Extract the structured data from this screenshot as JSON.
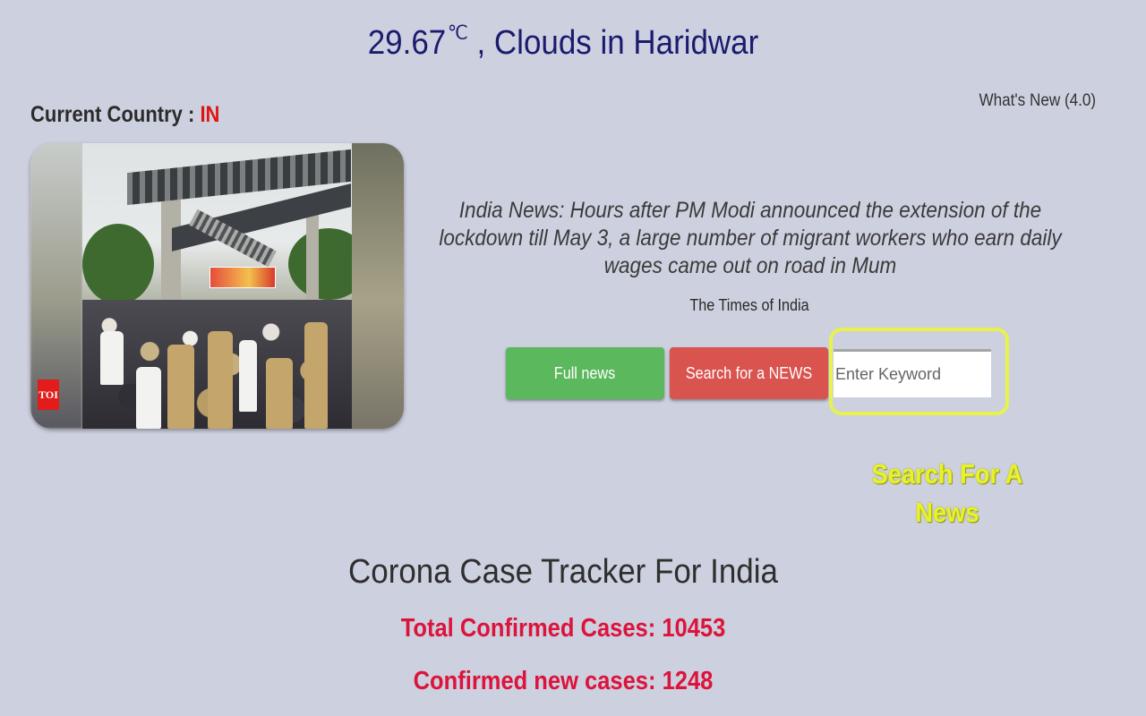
{
  "weather": {
    "temperature": "29.67",
    "unit": "℃",
    "condition_text": ", Clouds in Haridwar"
  },
  "whats_new": {
    "label": "What's New (4.0)"
  },
  "country": {
    "label": "Current Country : ",
    "code": "IN"
  },
  "news": {
    "image_badge": "TOI",
    "headline": "India News: Hours after PM Modi announced the extension of the lockdown till May 3, a large number of migrant workers who earn daily wages came out on road in Mum",
    "source": "The Times of India",
    "full_news_label": "Full news",
    "search_button_label": "Search for a NEWS",
    "keyword_placeholder": "Enter Keyword"
  },
  "annotation": {
    "line1": "Search For A",
    "line2": "News"
  },
  "tracker": {
    "title": "Corona Case Tracker For India",
    "total_confirmed": "Total Confirmed Cases: 10453",
    "new_confirmed": "Confirmed new cases: 1248"
  },
  "colors": {
    "background": "#cdd0df",
    "weather_text": "#1b1b6e",
    "country_code": "#e01414",
    "full_news_button": "#5cb85c",
    "search_button": "#d9534f",
    "highlight": "#e7f24b",
    "stat_text": "#dc143c"
  }
}
